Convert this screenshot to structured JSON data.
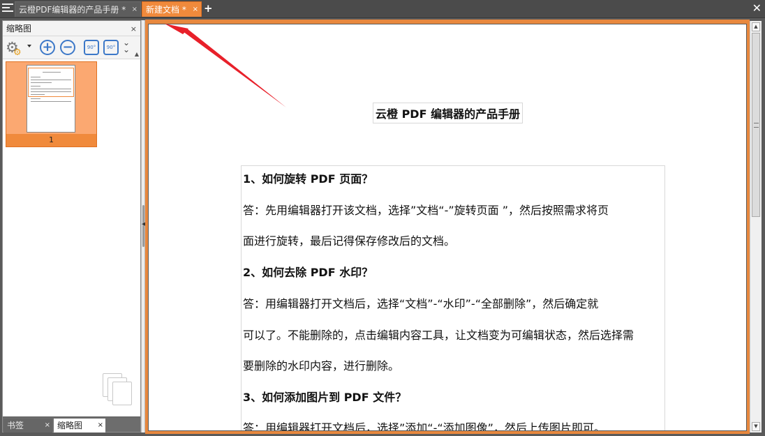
{
  "tabs": {
    "menu_icon": "menu-icon",
    "tab1_label": "云橙PDF编辑器的产品手册 *",
    "tab2_label": "新建文档 *",
    "close_glyph": "×",
    "add_tab": "+",
    "close_all": "✕"
  },
  "sidebar": {
    "title": "缩略图",
    "close": "×",
    "tools": {
      "rotate_left": "90°",
      "rotate_right": "90°"
    },
    "thumbnail": {
      "page_number": "1"
    },
    "bottom_tabs": [
      {
        "label": "书签"
      },
      {
        "label": "缩略图"
      }
    ]
  },
  "document": {
    "title": "云橙 PDF 编辑器的产品手册",
    "paragraphs": [
      {
        "text": "1、如何旋转  PDF  页面？",
        "bold": true
      },
      {
        "text": "答：先用编辑器打开该文档，选择”文档“-”旋转页面 ”，然后按照需求将页",
        "bold": false
      },
      {
        "text": "面进行旋转，最后记得保存修改后的文档。",
        "bold": false
      },
      {
        "text": "2、如何去除  PDF  水印？",
        "bold": true
      },
      {
        "text": "答：用编辑器打开文档后，选择“文档”-“水印”-“全部删除”，然后确定就",
        "bold": false
      },
      {
        "text": "可以了。不能删除的，点击编辑内容工具，让文档变为可编辑状态，然后选择需",
        "bold": false
      },
      {
        "text": "要删除的水印内容，进行删除。",
        "bold": false
      },
      {
        "text": "3、如何添加图片到  PDF  文件？",
        "bold": true
      },
      {
        "text": "答：用编辑器打开文档后，选择”添加“-“添加图像”，然后上传图片即可。",
        "bold": false
      }
    ]
  },
  "colors": {
    "accent": "#f08a3c",
    "annotation_arrow": "#e8202a"
  }
}
